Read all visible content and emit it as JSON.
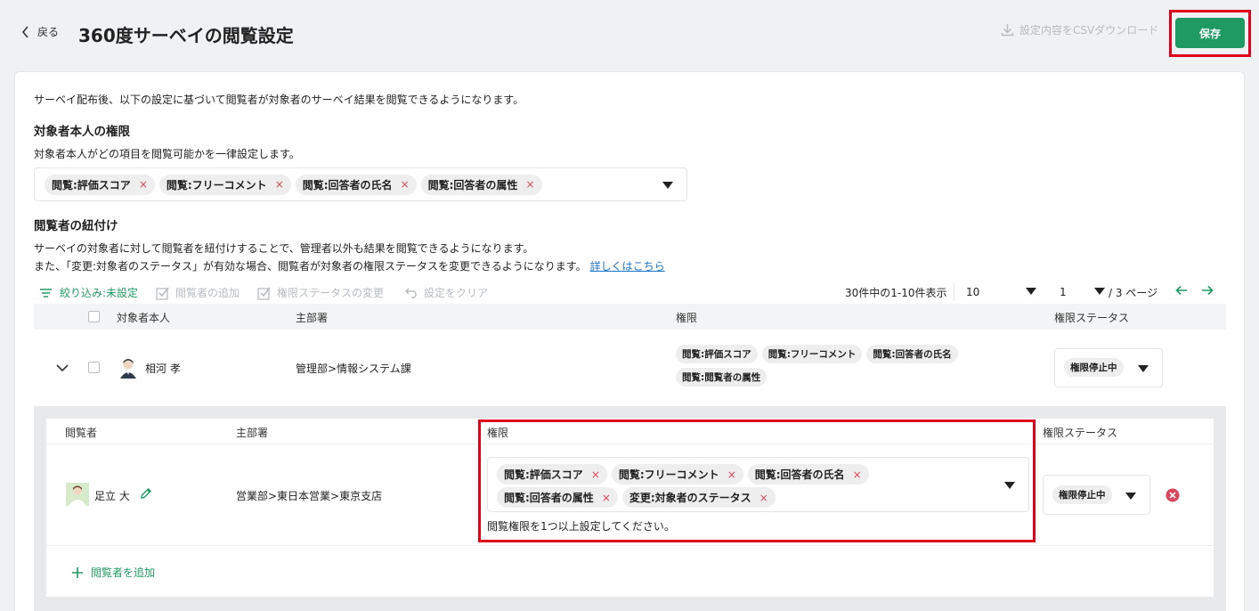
{
  "header": {
    "back_label": "戻る",
    "title": "360度サーベイの閲覧設定",
    "csv_download_label": "設定内容をCSVダウンロード",
    "save_label": "保存"
  },
  "intro": "サーベイ配布後、以下の設定に基づいて閲覧者が対象者のサーベイ結果を閲覧できるようになります。",
  "self_permissions": {
    "heading": "対象者本人の権限",
    "description": "対象者本人がどの項目を閲覧可能かを一律設定します。",
    "chips": [
      "閲覧:評価スコア",
      "閲覧:フリーコメント",
      "閲覧:回答者の氏名",
      "閲覧:回答者の属性"
    ]
  },
  "viewer_link": {
    "heading": "閲覧者の紐付け",
    "description1": "サーベイの対象者に対して閲覧者を紐付けすることで、管理者以外も結果を閲覧できるようになります。",
    "description2": "また、「変更:対象者のステータス」が有効な場合、閲覧者が対象者の権限ステータスを変更できるようになります。",
    "details_link": "詳しくはこちら"
  },
  "toolbar": {
    "filter_label": "絞り込み:未設定",
    "add_viewer_label": "閲覧者の追加",
    "change_status_label": "権限ステータスの変更",
    "clear_label": "設定をクリア",
    "range_text": "30件中の1-10件表示",
    "per_page": "10",
    "page_current": "1",
    "page_total": "/ 3 ページ"
  },
  "table": {
    "headers": [
      "対象者本人",
      "主部署",
      "権限",
      "権限ステータス"
    ],
    "row": {
      "name": "相河 孝",
      "department": "管理部>情報システム課",
      "chips": [
        "閲覧:評価スコア",
        "閲覧:フリーコメント",
        "閲覧:回答者の氏名",
        "閲覧:閲覧者の属性"
      ],
      "status": "権限停止中"
    }
  },
  "viewer_table": {
    "headers": [
      "閲覧者",
      "主部署",
      "権限",
      "権限ステータス"
    ],
    "row": {
      "name": "足立 大",
      "department": "営業部>東日本営業>東京支店",
      "chips": [
        "閲覧:評価スコア",
        "閲覧:フリーコメント",
        "閲覧:回答者の氏名",
        "閲覧:回答者の属性",
        "変更:対象者のステータス"
      ],
      "error": "閲覧権限を1つ以上設定してください。",
      "status": "権限停止中"
    },
    "add_viewer_label": "閲覧者を追加"
  },
  "colors": {
    "accent": "#1f9a63",
    "highlight": "#e0001b",
    "remove": "#d9455a"
  }
}
